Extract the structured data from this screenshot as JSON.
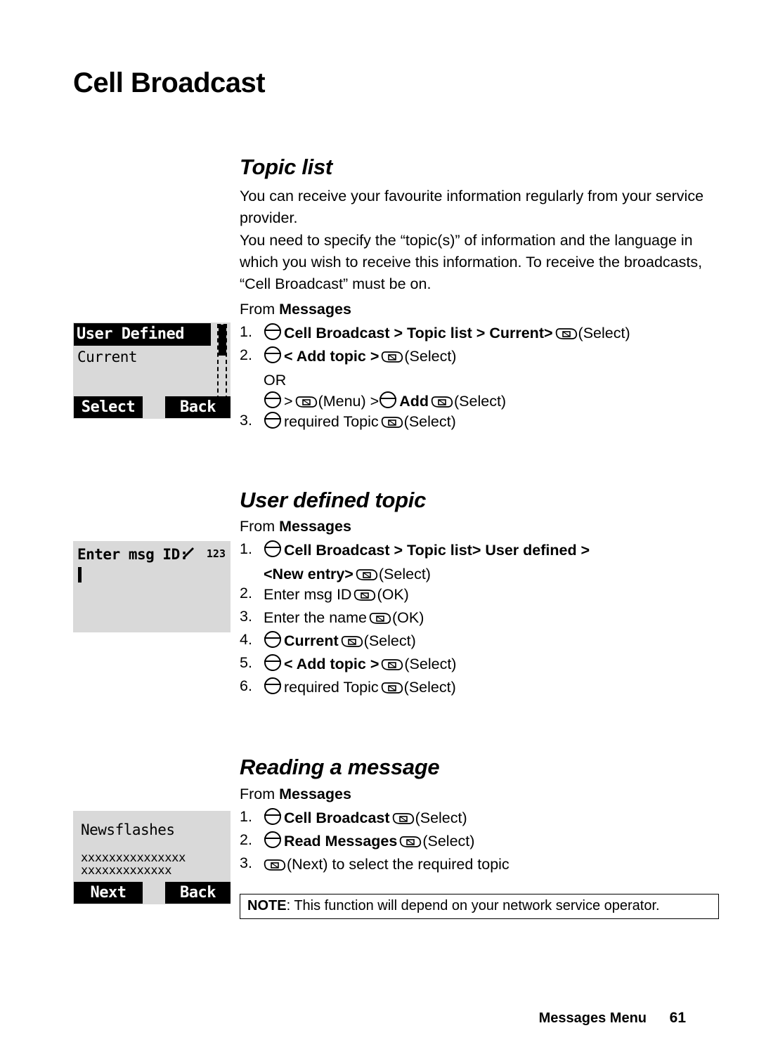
{
  "document": {
    "title": "Cell Broadcast",
    "footer": {
      "label": "Messages Menu",
      "page_number": "61"
    },
    "note": {
      "prefix": "NOTE",
      "text": ": This function will depend on your network service operator."
    }
  },
  "sections": [
    {
      "heading": "Topic list",
      "paragraph_1": "You can receive your favourite information regularly from your service provider.",
      "paragraph_2": "You need to specify the “topic(s)” of information and the language in which you wish to receive this information. To receive the broadcasts, “Cell Broadcast” must be on.",
      "from_prefix": "From ",
      "from_target": "Messages",
      "steps": [
        {
          "num": "1.",
          "parts": [
            "Cell Broadcast > Topic list > Current>",
            "(Select)"
          ]
        },
        {
          "num": "2.",
          "parts": [
            "< Add topic >",
            "(Select)"
          ]
        },
        {
          "num": "",
          "or": "OR",
          "parts": [
            ">",
            "(Menu) >",
            "Add",
            "(Select)"
          ]
        },
        {
          "num": "3.",
          "parts": [
            "required Topic",
            "(Select)"
          ]
        }
      ]
    },
    {
      "heading": "User defined topic",
      "from_prefix": "From ",
      "from_target": "Messages",
      "steps": [
        {
          "num": "1.",
          "line1": "Cell Broadcast > Topic list> User defined >",
          "line2": "<New entry>",
          "line2_suffix": "(Select)"
        },
        {
          "num": "2.",
          "text": "Enter msg ID",
          "suffix": "(OK)"
        },
        {
          "num": "3.",
          "text": "Enter the name",
          "suffix": "(OK)"
        },
        {
          "num": "4.",
          "text": "Current",
          "suffix": "(Select)"
        },
        {
          "num": "5.",
          "text": "< Add topic >",
          "suffix": "(Select)"
        },
        {
          "num": "6.",
          "text": "required Topic",
          "suffix": "(Select)"
        }
      ]
    },
    {
      "heading": "Reading a message",
      "from_prefix": "From ",
      "from_target": "Messages",
      "steps": [
        {
          "num": "1.",
          "text": "Cell Broadcast",
          "suffix": "(Select)"
        },
        {
          "num": "2.",
          "text": "Read Messages",
          "suffix": "(Select)"
        },
        {
          "num": "3.",
          "text": "",
          "suffix": "(Next) to select the required topic"
        }
      ]
    }
  ],
  "screens": {
    "topic_list": {
      "title": "User Defined",
      "row": "Current",
      "softkey_left": "Select",
      "softkey_right": "Back"
    },
    "enter_msg_id": {
      "title": "Enter msg ID:",
      "indicator": "123"
    },
    "newsflashes": {
      "title": "Newsflashes",
      "line1": "xxxxxxxxxxxxxxx",
      "line2": "xxxxxxxxxxxxx",
      "softkey_left": "Next",
      "softkey_right": "Back"
    }
  }
}
